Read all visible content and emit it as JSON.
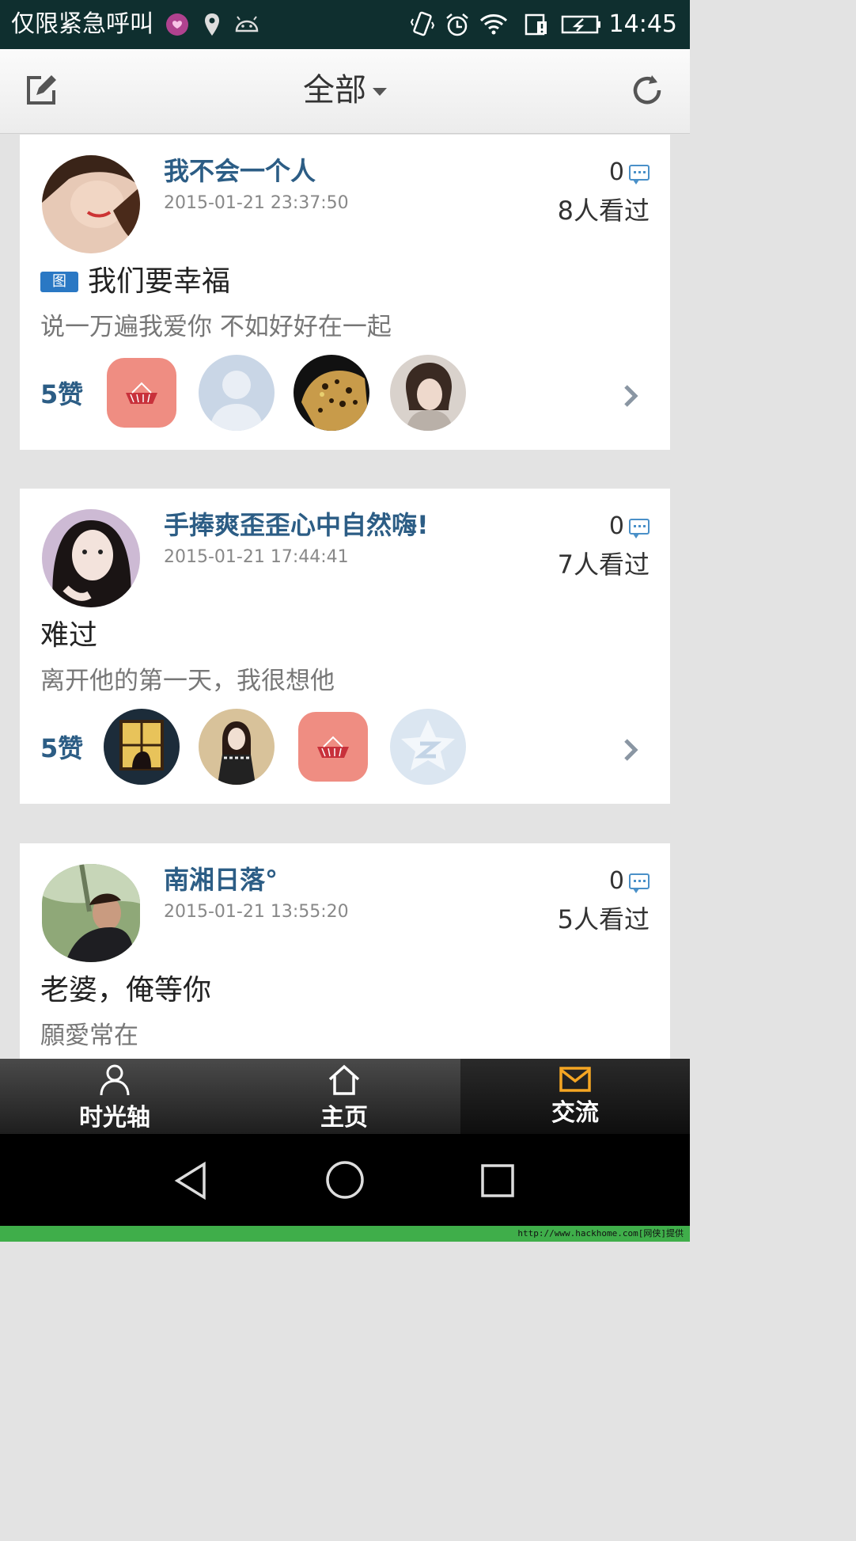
{
  "status_bar": {
    "carrier": "仅限紧急呼叫",
    "time": "14:45"
  },
  "action_bar": {
    "title": "全部",
    "edit_icon": "edit-icon",
    "refresh_icon": "refresh-icon"
  },
  "posts": [
    {
      "username": "我不会一个人",
      "time": "2015-01-21 23:37:50",
      "comments": "0",
      "views": "8人看过",
      "has_image_tag": true,
      "image_tag": "图",
      "title": "我们要幸福",
      "body": "说一万遍我爱你 不如好好在一起",
      "likes": "5赞"
    },
    {
      "username": "手捧爽歪歪心中自然嗨!",
      "time": "2015-01-21 17:44:41",
      "comments": "0",
      "views": "7人看过",
      "has_image_tag": false,
      "title": "难过",
      "body": "离开他的第一天，我很想他",
      "likes": "5赞"
    },
    {
      "username": "南湘日落°",
      "time": "2015-01-21 13:55:20",
      "comments": "0",
      "views": "5人看过",
      "has_image_tag": false,
      "title": "老婆，俺等你",
      "body": "願愛常在"
    }
  ],
  "tabs": [
    {
      "label": "时光轴",
      "icon": "person-icon",
      "active": false
    },
    {
      "label": "主页",
      "icon": "home-icon",
      "active": false
    },
    {
      "label": "交流",
      "icon": "mail-icon",
      "active": true
    }
  ],
  "footer": "http://www.hackhome.com[网侠]提供",
  "colors": {
    "accent": "#2c5d85",
    "active_tab_icon": "#f5a623"
  }
}
